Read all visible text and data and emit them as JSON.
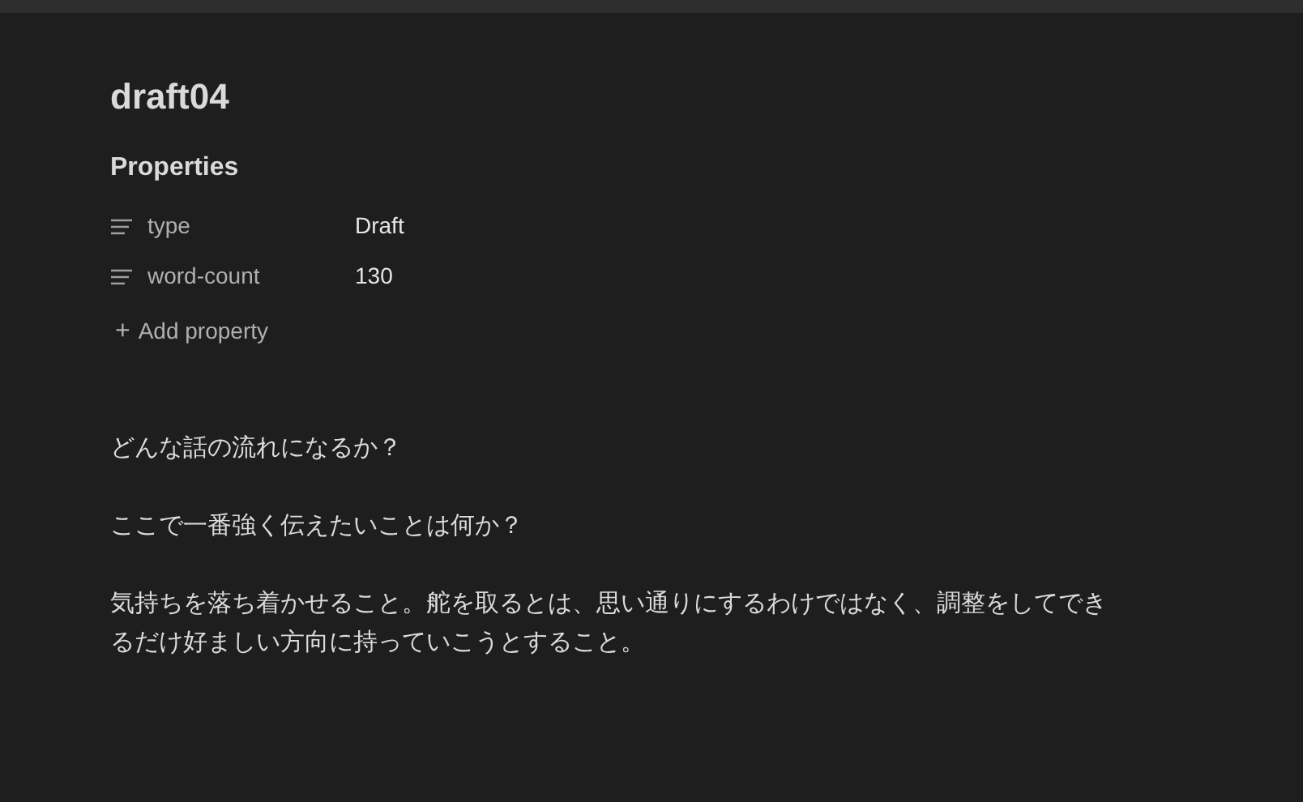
{
  "note": {
    "title": "draft04",
    "properties_heading": "Properties",
    "properties": [
      {
        "name": "type",
        "value": "Draft"
      },
      {
        "name": "word-count",
        "value": "130"
      }
    ],
    "add_property": {
      "icon": "+",
      "label": "Add property"
    },
    "paragraphs": [
      "どんな話の流れになるか？",
      "ここで一番強く伝えたいことは何か？",
      "気持ちを落ち着かせること。舵を取るとは、思い通りにするわけではなく、調整をしてできるだけ好ましい方向に持っていこうとすること。"
    ]
  }
}
